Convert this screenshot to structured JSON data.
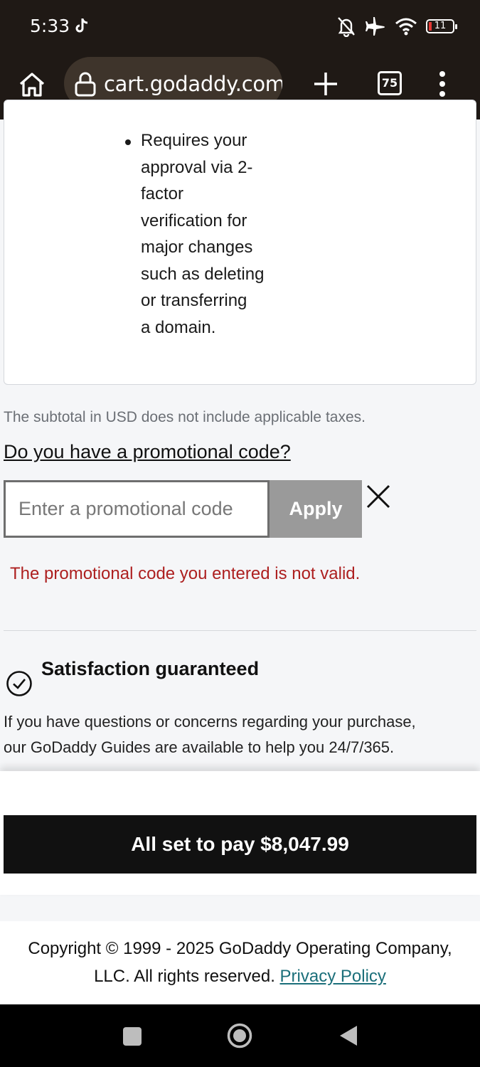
{
  "status_bar": {
    "time": "5:33",
    "battery_level": "11",
    "icons": [
      "tiktok-icon",
      "mute-icon",
      "airplane-icon",
      "wifi-icon",
      "battery-icon"
    ]
  },
  "browser": {
    "url": "cart.godaddy.com",
    "tab_count": "75"
  },
  "card": {
    "bullet_lines": [
      "Requires your",
      "approval via 2-",
      "factor",
      "verification for",
      "major changes",
      "such as deleting",
      "or transferring",
      "a domain."
    ]
  },
  "cart": {
    "subtotal_note": "The subtotal in USD does not include applicable taxes.",
    "promo_link": "Do you have a promotional code?",
    "promo_placeholder": "Enter a promotional code",
    "promo_value": "",
    "apply_label": "Apply",
    "error_message": "The promotional code you entered is not valid."
  },
  "guarantee": {
    "title": "Satisfaction guaranteed",
    "line1": "If you have questions or concerns regarding your purchase,",
    "line2": "our GoDaddy Guides are available to help you 24/7/365."
  },
  "checkout": {
    "pay_label": "All set to pay $8,047.99"
  },
  "footer": {
    "copyright_line1": "Copyright © 1999 - 2025 GoDaddy Operating Company,",
    "copyright_line2": "LLC. All rights reserved.",
    "privacy_link": "Privacy Policy"
  },
  "colors": {
    "browser_bar": "#1f1915",
    "error": "#ad1f1f",
    "link": "#1b6f7a",
    "pay_button": "#111111"
  }
}
